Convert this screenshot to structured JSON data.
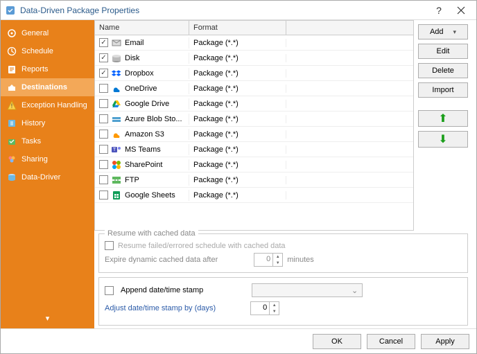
{
  "window": {
    "title": "Data-Driven Package Properties"
  },
  "sidebar": {
    "items": [
      {
        "label": "General"
      },
      {
        "label": "Schedule"
      },
      {
        "label": "Reports"
      },
      {
        "label": "Destinations"
      },
      {
        "label": "Exception Handling"
      },
      {
        "label": "History"
      },
      {
        "label": "Tasks"
      },
      {
        "label": "Sharing"
      },
      {
        "label": "Data-Driver"
      }
    ],
    "active_index": 3
  },
  "grid": {
    "headers": {
      "name": "Name",
      "format": "Format"
    },
    "rows": [
      {
        "checked": true,
        "icon": "email",
        "name": "Email",
        "format": "Package (*.*)"
      },
      {
        "checked": true,
        "icon": "disk",
        "name": "Disk",
        "format": "Package (*.*)"
      },
      {
        "checked": true,
        "icon": "dropbox",
        "name": "Dropbox",
        "format": "Package (*.*)"
      },
      {
        "checked": false,
        "icon": "onedrive",
        "name": "OneDrive",
        "format": "Package (*.*)"
      },
      {
        "checked": false,
        "icon": "gdrive",
        "name": "Google Drive",
        "format": "Package (*.*)"
      },
      {
        "checked": false,
        "icon": "azure",
        "name": "Azure Blob Sto...",
        "format": "Package (*.*)"
      },
      {
        "checked": false,
        "icon": "s3",
        "name": "Amazon S3",
        "format": "Package (*.*)"
      },
      {
        "checked": false,
        "icon": "teams",
        "name": "MS Teams",
        "format": "Package (*.*)"
      },
      {
        "checked": false,
        "icon": "sharept",
        "name": "SharePoint",
        "format": "Package (*.*)"
      },
      {
        "checked": false,
        "icon": "ftp",
        "name": "FTP",
        "format": "Package (*.*)"
      },
      {
        "checked": false,
        "icon": "gsheets",
        "name": "Google Sheets",
        "format": "Package (*.*)"
      }
    ]
  },
  "buttons": {
    "add": "Add",
    "edit": "Edit",
    "delete": "Delete",
    "import": "Import"
  },
  "resume": {
    "legend": "Resume with cached data",
    "resume_label": "Resume failed/errored schedule with cached data",
    "expire_label": "Expire dynamic cached data after",
    "expire_value": "0",
    "expire_unit": "minutes"
  },
  "append": {
    "label": "Append date/time stamp",
    "checked": false,
    "adjust_label": "Adjust date/time stamp by (days)",
    "adjust_value": "0"
  },
  "footer": {
    "ok": "OK",
    "cancel": "Cancel",
    "apply": "Apply"
  }
}
